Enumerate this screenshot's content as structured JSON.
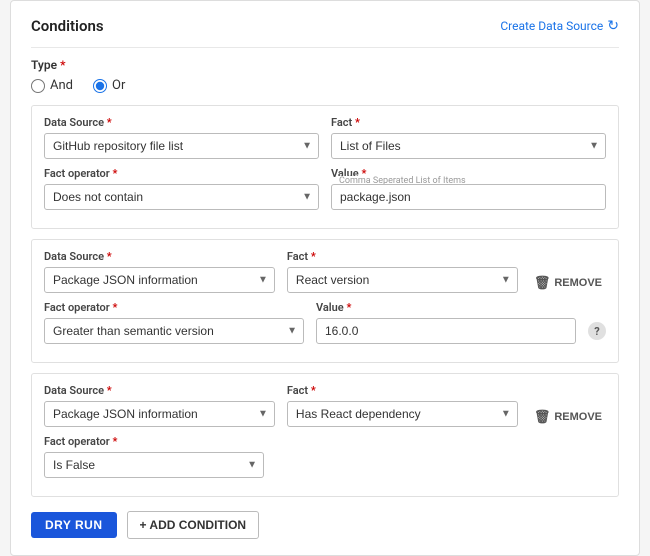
{
  "panel": {
    "title": "Conditions",
    "create_datasource_label": "Create Data Source",
    "type_label": "Type",
    "radio_options": [
      {
        "label": "And",
        "value": "and"
      },
      {
        "label": "Or",
        "value": "or"
      }
    ],
    "selected_radio": "or"
  },
  "condition1": {
    "data_source_label": "Data Source",
    "data_source_value": "GitHub repository file list",
    "fact_label": "Fact",
    "fact_value": "List of Files",
    "fact_operator_label": "Fact operator",
    "fact_operator_value": "Does not contain",
    "value_label": "Value",
    "value_placeholder": "Comma Seperated List of Items",
    "value_value": "package.json"
  },
  "condition2": {
    "data_source_label": "Data Source",
    "data_source_value": "Package JSON information",
    "fact_label": "Fact",
    "fact_value": "React version",
    "fact_operator_label": "Fact operator",
    "fact_operator_value": "Greater than semantic version",
    "value_label": "Value",
    "value_value": "16.0.0",
    "remove_label": "REMOVE"
  },
  "condition3": {
    "data_source_label": "Data Source",
    "data_source_value": "Package JSON information",
    "fact_label": "Fact",
    "fact_value": "Has React dependency",
    "fact_operator_label": "Fact operator",
    "fact_operator_value": "Is False",
    "remove_label": "REMOVE"
  },
  "footer": {
    "dry_run_label": "DRY RUN",
    "add_condition_label": "+ ADD CONDITION"
  }
}
